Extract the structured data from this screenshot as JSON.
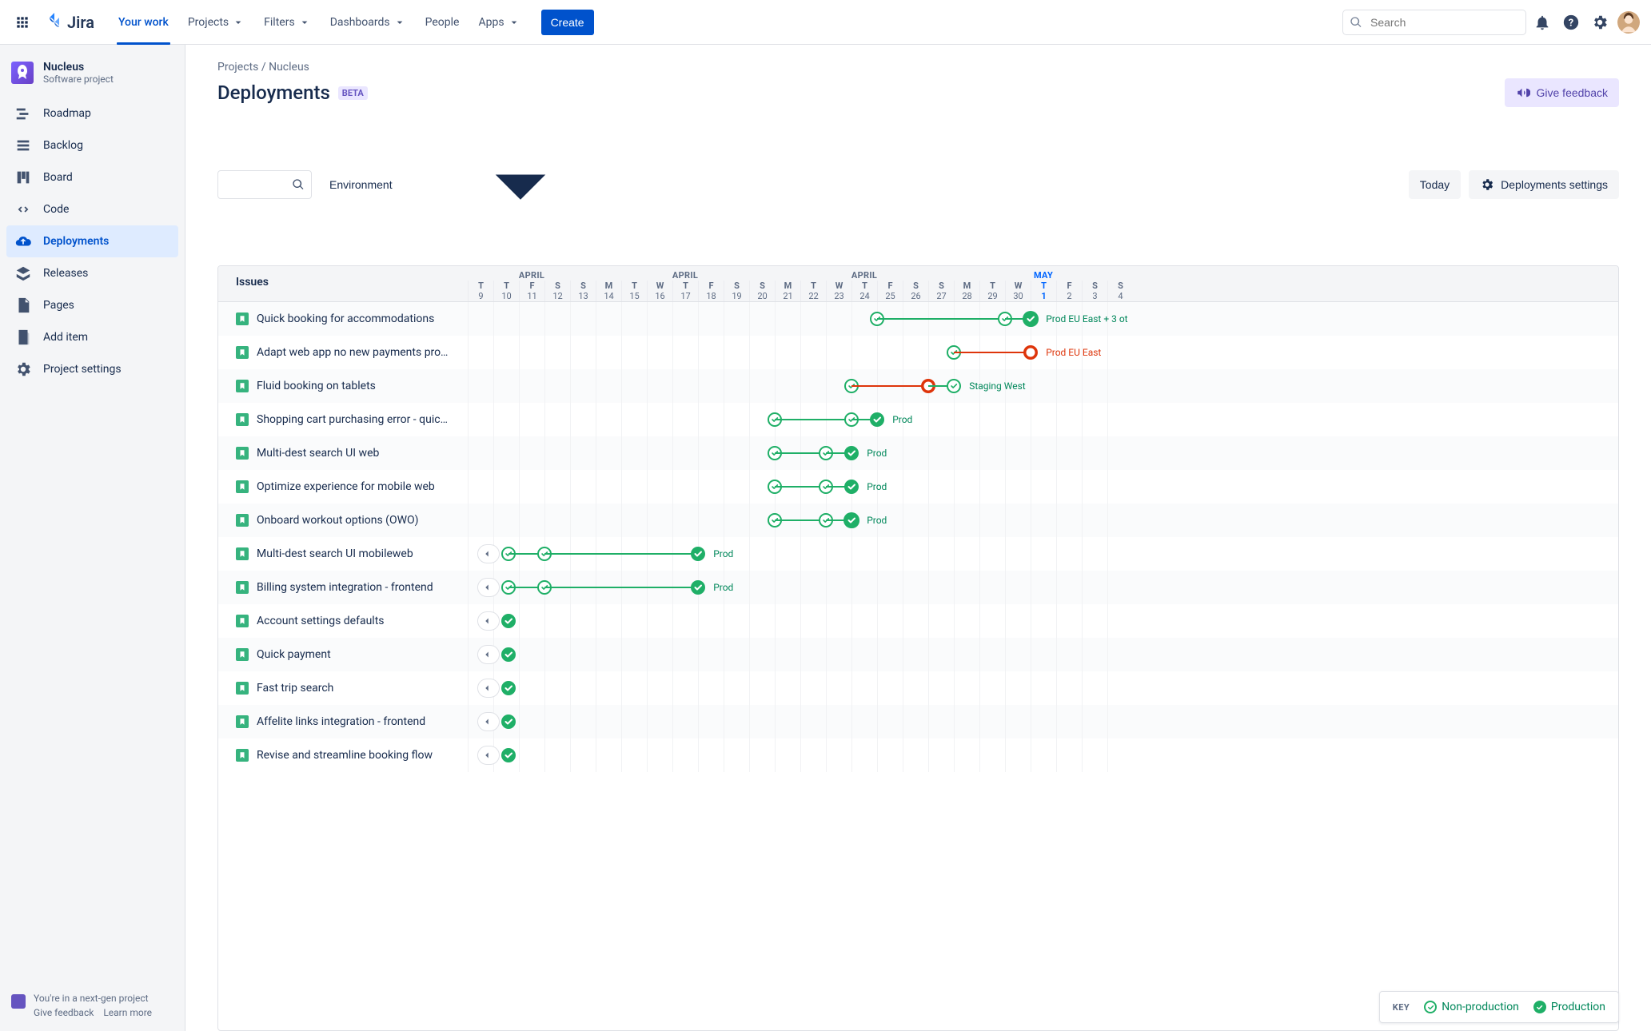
{
  "topnav": {
    "brand": "Jira",
    "items": [
      {
        "label": "Your work",
        "dropdown": false,
        "active": true
      },
      {
        "label": "Projects",
        "dropdown": true
      },
      {
        "label": "Filters",
        "dropdown": true
      },
      {
        "label": "Dashboards",
        "dropdown": true
      },
      {
        "label": "People",
        "dropdown": false
      },
      {
        "label": "Apps",
        "dropdown": true
      }
    ],
    "create": "Create",
    "search_placeholder": "Search"
  },
  "project": {
    "name": "Nucleus",
    "type": "Software project"
  },
  "sidebar": {
    "items": [
      {
        "label": "Roadmap",
        "icon": "roadmap"
      },
      {
        "label": "Backlog",
        "icon": "backlog"
      },
      {
        "label": "Board",
        "icon": "board"
      },
      {
        "label": "Code",
        "icon": "code"
      },
      {
        "label": "Deployments",
        "icon": "deploy",
        "selected": true
      },
      {
        "label": "Releases",
        "icon": "release"
      },
      {
        "label": "Pages",
        "icon": "pages"
      },
      {
        "label": "Add item",
        "icon": "add"
      },
      {
        "label": "Project settings",
        "icon": "settings"
      }
    ],
    "footer": {
      "text": "You're in a next-gen project",
      "feedback": "Give feedback",
      "learn": "Learn more"
    }
  },
  "breadcrumb": {
    "root": "Projects",
    "sep": " / ",
    "proj": "Nucleus"
  },
  "page": {
    "title": "Deployments",
    "beta": "BETA"
  },
  "actions": {
    "feedback": "Give feedback",
    "env": "Environment",
    "today": "Today",
    "settings": "Deployments settings"
  },
  "issues_header": "Issues",
  "calendar": {
    "months": [
      {
        "label": "APRIL",
        "span": 5
      },
      {
        "label": "APRIL",
        "span": 7
      },
      {
        "label": "APRIL",
        "span": 7
      },
      {
        "label": "MAY",
        "span": 7,
        "today": true
      }
    ],
    "days": [
      {
        "dow": "T",
        "num": "9"
      },
      {
        "dow": "T",
        "num": "10"
      },
      {
        "dow": "F",
        "num": "11"
      },
      {
        "dow": "S",
        "num": "12"
      },
      {
        "dow": "S",
        "num": "13"
      },
      {
        "dow": "M",
        "num": "14"
      },
      {
        "dow": "T",
        "num": "15"
      },
      {
        "dow": "W",
        "num": "16"
      },
      {
        "dow": "T",
        "num": "17"
      },
      {
        "dow": "F",
        "num": "18"
      },
      {
        "dow": "S",
        "num": "19"
      },
      {
        "dow": "S",
        "num": "20"
      },
      {
        "dow": "M",
        "num": "21"
      },
      {
        "dow": "T",
        "num": "22"
      },
      {
        "dow": "W",
        "num": "23"
      },
      {
        "dow": "T",
        "num": "24"
      },
      {
        "dow": "F",
        "num": "25"
      },
      {
        "dow": "S",
        "num": "26"
      },
      {
        "dow": "S",
        "num": "27"
      },
      {
        "dow": "M",
        "num": "28"
      },
      {
        "dow": "T",
        "num": "29"
      },
      {
        "dow": "W",
        "num": "30"
      },
      {
        "dow": "T",
        "num": "1",
        "today": true
      },
      {
        "dow": "F",
        "num": "2"
      },
      {
        "dow": "S",
        "num": "3"
      },
      {
        "dow": "S",
        "num": "4"
      }
    ]
  },
  "issues": [
    {
      "title": "Quick booking for accommodations",
      "deploys": [
        {
          "type": "node",
          "style": "outline",
          "x": 16
        },
        {
          "type": "seg",
          "style": "green",
          "from": 16,
          "to": 21
        },
        {
          "type": "node",
          "style": "outline",
          "x": 21
        },
        {
          "type": "seg",
          "style": "green",
          "from": 21,
          "to": 22
        },
        {
          "type": "node",
          "style": "stack",
          "x": 22
        },
        {
          "type": "label",
          "style": "green",
          "x": 22.6,
          "text": "Prod EU East + 3 ot"
        }
      ]
    },
    {
      "title": "Adapt web app no new payments provider",
      "deploys": [
        {
          "type": "node",
          "style": "outline",
          "x": 19
        },
        {
          "type": "seg",
          "style": "red",
          "from": 19,
          "to": 22
        },
        {
          "type": "node",
          "style": "warn",
          "x": 22
        },
        {
          "type": "label",
          "style": "red",
          "x": 22.6,
          "text": "Prod EU East"
        }
      ]
    },
    {
      "title": "Fluid booking on tablets",
      "deploys": [
        {
          "type": "node",
          "style": "outline",
          "x": 15
        },
        {
          "type": "seg",
          "style": "red",
          "from": 15,
          "to": 18
        },
        {
          "type": "node",
          "style": "warn",
          "x": 18
        },
        {
          "type": "seg",
          "style": "green",
          "from": 18,
          "to": 19
        },
        {
          "type": "node",
          "style": "outline",
          "x": 19
        },
        {
          "type": "label",
          "style": "green",
          "x": 19.6,
          "text": "Staging West"
        }
      ]
    },
    {
      "title": "Shopping cart purchasing error - quick fix",
      "deploys": [
        {
          "type": "node",
          "style": "outline",
          "x": 12
        },
        {
          "type": "seg",
          "style": "green",
          "from": 12,
          "to": 15
        },
        {
          "type": "node",
          "style": "outline",
          "x": 15
        },
        {
          "type": "seg",
          "style": "green",
          "from": 15,
          "to": 16
        },
        {
          "type": "node",
          "style": "solid",
          "x": 16
        },
        {
          "type": "label",
          "style": "green",
          "x": 16.6,
          "text": "Prod"
        }
      ]
    },
    {
      "title": "Multi-dest search UI web",
      "deploys": [
        {
          "type": "node",
          "style": "outline",
          "x": 12
        },
        {
          "type": "seg",
          "style": "green",
          "from": 12,
          "to": 14
        },
        {
          "type": "node",
          "style": "outline",
          "x": 14
        },
        {
          "type": "seg",
          "style": "green",
          "from": 14,
          "to": 15
        },
        {
          "type": "node",
          "style": "solid",
          "x": 15
        },
        {
          "type": "label",
          "style": "green",
          "x": 15.6,
          "text": "Prod"
        }
      ]
    },
    {
      "title": "Optimize experience for mobile web",
      "deploys": [
        {
          "type": "node",
          "style": "outline",
          "x": 12
        },
        {
          "type": "seg",
          "style": "green",
          "from": 12,
          "to": 14
        },
        {
          "type": "node",
          "style": "outline",
          "x": 14
        },
        {
          "type": "seg",
          "style": "green",
          "from": 14,
          "to": 15
        },
        {
          "type": "node",
          "style": "solid",
          "x": 15
        },
        {
          "type": "label",
          "style": "green",
          "x": 15.6,
          "text": "Prod"
        }
      ]
    },
    {
      "title": "Onboard workout options (OWO)",
      "deploys": [
        {
          "type": "node",
          "style": "outline",
          "x": 12
        },
        {
          "type": "seg",
          "style": "green",
          "from": 12,
          "to": 14
        },
        {
          "type": "node",
          "style": "outline",
          "x": 14
        },
        {
          "type": "seg",
          "style": "green",
          "from": 14,
          "to": 15
        },
        {
          "type": "node",
          "style": "stack",
          "x": 15
        },
        {
          "type": "label",
          "style": "green",
          "x": 15.6,
          "text": "Prod"
        }
      ]
    },
    {
      "title": "Multi-dest search UI mobileweb",
      "deploys": [
        {
          "type": "more",
          "x": 0.8
        },
        {
          "type": "node",
          "style": "outline",
          "x": 1.6
        },
        {
          "type": "seg",
          "style": "green",
          "from": 1.6,
          "to": 3
        },
        {
          "type": "node",
          "style": "outline",
          "x": 3
        },
        {
          "type": "seg",
          "style": "green",
          "from": 3,
          "to": 9
        },
        {
          "type": "node",
          "style": "solid",
          "x": 9
        },
        {
          "type": "label",
          "style": "green",
          "x": 9.6,
          "text": "Prod"
        }
      ]
    },
    {
      "title": "Billing system integration - frontend",
      "deploys": [
        {
          "type": "more",
          "x": 0.8
        },
        {
          "type": "node",
          "style": "outline",
          "x": 1.6
        },
        {
          "type": "seg",
          "style": "green",
          "from": 1.6,
          "to": 3
        },
        {
          "type": "node",
          "style": "outline",
          "x": 3
        },
        {
          "type": "seg",
          "style": "green",
          "from": 3,
          "to": 9
        },
        {
          "type": "node",
          "style": "solid",
          "x": 9
        },
        {
          "type": "label",
          "style": "green",
          "x": 9.6,
          "text": "Prod"
        }
      ]
    },
    {
      "title": "Account settings defaults",
      "deploys": [
        {
          "type": "more",
          "x": 0.8
        },
        {
          "type": "node",
          "style": "solid",
          "x": 1.6
        }
      ]
    },
    {
      "title": "Quick payment",
      "deploys": [
        {
          "type": "more",
          "x": 0.8
        },
        {
          "type": "node",
          "style": "solid",
          "x": 1.6
        }
      ]
    },
    {
      "title": "Fast trip search",
      "deploys": [
        {
          "type": "more",
          "x": 0.8
        },
        {
          "type": "node",
          "style": "solid",
          "x": 1.6
        }
      ]
    },
    {
      "title": "Affelite links integration - frontend",
      "deploys": [
        {
          "type": "more",
          "x": 0.8
        },
        {
          "type": "node",
          "style": "solid",
          "x": 1.6
        }
      ]
    },
    {
      "title": "Revise and streamline booking flow",
      "deploys": [
        {
          "type": "more",
          "x": 0.8
        },
        {
          "type": "node",
          "style": "solid",
          "x": 1.6
        }
      ]
    }
  ],
  "key": {
    "label": "KEY",
    "nonprod": "Non-production",
    "prod": "Production"
  }
}
